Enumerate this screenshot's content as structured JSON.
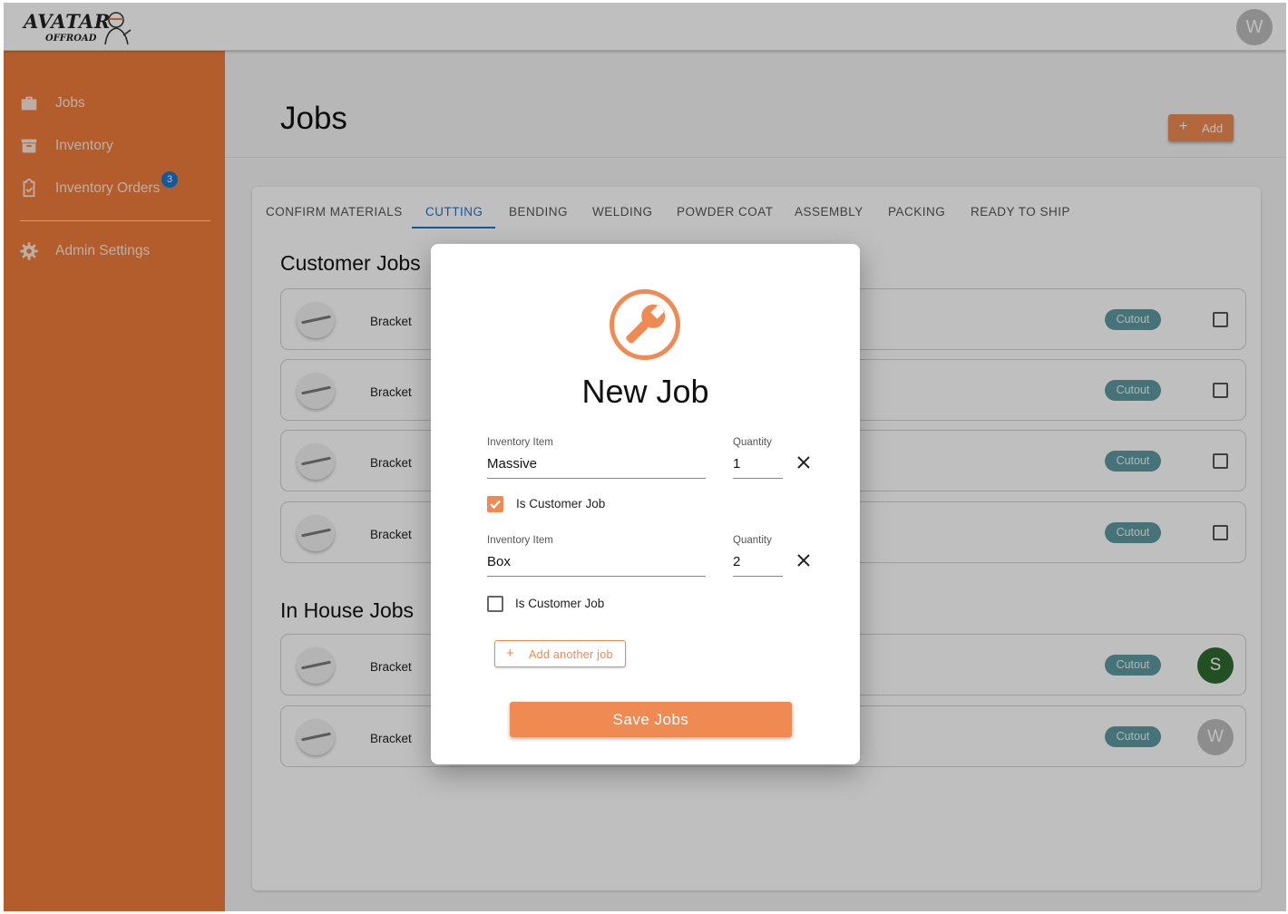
{
  "app": {
    "logo": {
      "line1": "AVATAR",
      "line2": "OFFROAD"
    },
    "user_avatar": "W"
  },
  "sidebar": {
    "items": [
      {
        "label": "Jobs",
        "icon": "briefcase-icon"
      },
      {
        "label": "Inventory",
        "icon": "archive-icon"
      },
      {
        "label": "Inventory Orders",
        "icon": "clipboard-check-icon",
        "badge": "3"
      },
      {
        "label": "Admin Settings",
        "icon": "gear-icon"
      }
    ]
  },
  "page": {
    "title": "Jobs",
    "add_label": "Add"
  },
  "tabs": [
    {
      "label": "CONFIRM MATERIALS"
    },
    {
      "label": "CUTTING",
      "active": true
    },
    {
      "label": "BENDING"
    },
    {
      "label": "WELDING"
    },
    {
      "label": "POWDER COAT"
    },
    {
      "label": "ASSEMBLY"
    },
    {
      "label": "PACKING"
    },
    {
      "label": "READY TO SHIP"
    }
  ],
  "customer_jobs": {
    "title": "Customer Jobs",
    "rows": [
      {
        "name": "Bracket",
        "status": "Cutout"
      },
      {
        "name": "Bracket",
        "status": "Cutout"
      },
      {
        "name": "Bracket",
        "status": "Cutout"
      },
      {
        "name": "Bracket",
        "status": "Cutout"
      }
    ]
  },
  "in_house_jobs": {
    "title": "In House Jobs",
    "rows": [
      {
        "name": "Bracket",
        "status": "Cutout",
        "assignee": "S",
        "assignee_color": "#2e6b2e"
      },
      {
        "name": "Bracket",
        "status": "Cutout",
        "assignee": "W",
        "assignee_color": "#bdbdbd"
      }
    ]
  },
  "modal": {
    "title": "New Job",
    "icon": "wrench-icon",
    "jobs": [
      {
        "item_label": "Inventory Item",
        "item_value": "Massive",
        "qty_label": "Quantity",
        "qty_value": "1",
        "customer_label": "Is Customer Job",
        "is_customer": true
      },
      {
        "item_label": "Inventory Item",
        "item_value": "Box",
        "qty_label": "Quantity",
        "qty_value": "2",
        "customer_label": "Is Customer Job",
        "is_customer": false
      }
    ],
    "add_another_label": "Add another job",
    "save_label": "Save Jobs"
  },
  "colors": {
    "brand": "#ef7d3b",
    "accent_button": "#ef8a52",
    "active_tab": "#1976d2",
    "status_chip": "#5c9aa1"
  }
}
